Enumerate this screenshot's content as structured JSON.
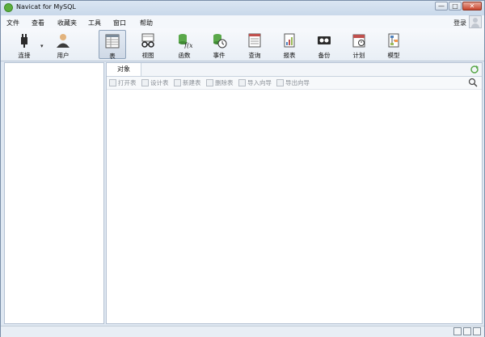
{
  "window": {
    "title": "Navicat for MySQL",
    "minimize": "—",
    "maximize": "□",
    "close": "✕"
  },
  "menu": [
    "文件",
    "查看",
    "收藏夹",
    "工具",
    "窗口",
    "帮助"
  ],
  "account": {
    "login_label": "登录"
  },
  "toolbar": [
    {
      "label": "连接",
      "icon": "plug-icon"
    },
    {
      "label": "用户",
      "icon": "user-icon"
    },
    {
      "label": "表",
      "icon": "table-icon",
      "active": true
    },
    {
      "label": "视图",
      "icon": "view-icon"
    },
    {
      "label": "函数",
      "icon": "function-icon"
    },
    {
      "label": "事件",
      "icon": "event-icon"
    },
    {
      "label": "查询",
      "icon": "query-icon"
    },
    {
      "label": "报表",
      "icon": "report-icon"
    },
    {
      "label": "备份",
      "icon": "backup-icon"
    },
    {
      "label": "计划",
      "icon": "schedule-icon"
    },
    {
      "label": "模型",
      "icon": "model-icon"
    }
  ],
  "tabs": [
    {
      "label": "对象"
    }
  ],
  "object_actions": [
    "打开表",
    "设计表",
    "新建表",
    "删除表",
    "导入向导",
    "导出向导"
  ],
  "colors": {
    "accent_green": "#5cae3d",
    "titlebar": "#c9d8ea",
    "close_red": "#c8432c"
  }
}
